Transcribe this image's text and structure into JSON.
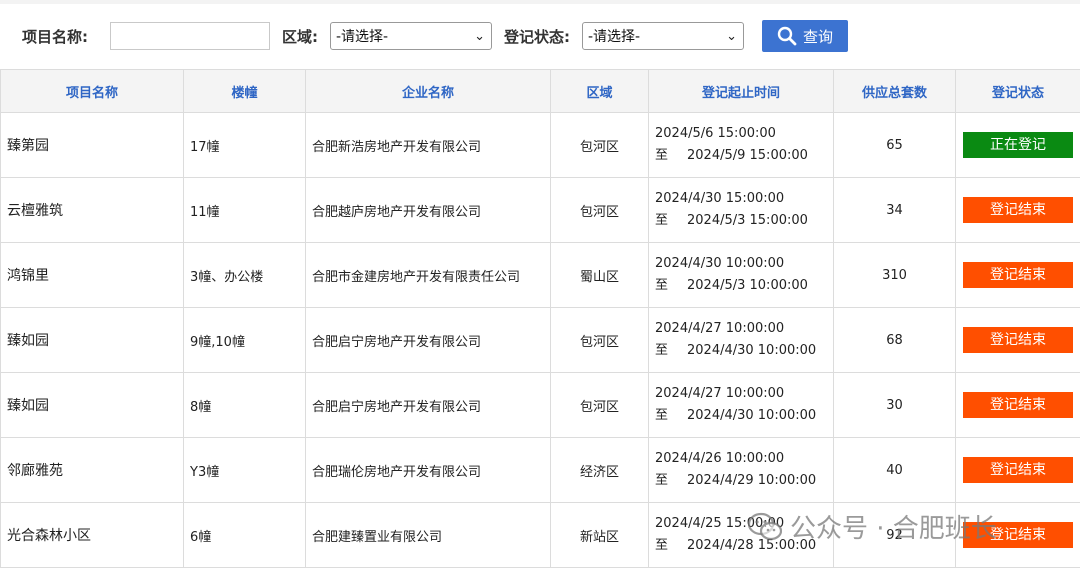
{
  "filters": {
    "project_label": "项目名称:",
    "project_value": "",
    "district_label": "区域:",
    "district_selected": "-请选择-",
    "status_label": "登记状态:",
    "status_selected": "-请选择-",
    "search_label": "查询",
    "search_icon": "search-icon"
  },
  "table": {
    "headers": [
      "项目名称",
      "楼幢",
      "企业名称",
      "区域",
      "登记起止时间",
      "供应总套数",
      "登记状态"
    ],
    "to_label": "至",
    "rows": [
      {
        "project": "臻第园",
        "building": "17幢",
        "company": "合肥新浩房地产开发有限公司",
        "district": "包河区",
        "start": "2024/5/6 15:00:00",
        "end": "2024/5/9 15:00:00",
        "total": "65",
        "status": "正在登记",
        "status_color": "#0a8a12"
      },
      {
        "project": "云檀雅筑",
        "building": "11幢",
        "company": "合肥越庐房地产开发有限公司",
        "district": "包河区",
        "start": "2024/4/30 15:00:00",
        "end": "2024/5/3 15:00:00",
        "total": "34",
        "status": "登记结束",
        "status_color": "#ff4f00"
      },
      {
        "project": "鸿锦里",
        "building": "3幢、办公楼",
        "company": "合肥市金建房地产开发有限责任公司",
        "district": "蜀山区",
        "start": "2024/4/30 10:00:00",
        "end": "2024/5/3 10:00:00",
        "total": "310",
        "status": "登记结束",
        "status_color": "#ff4f00"
      },
      {
        "project": "臻如园",
        "building": "9幢,10幢",
        "company": "合肥启宁房地产开发有限公司",
        "district": "包河区",
        "start": "2024/4/27 10:00:00",
        "end": "2024/4/30 10:00:00",
        "total": "68",
        "status": "登记结束",
        "status_color": "#ff4f00"
      },
      {
        "project": "臻如园",
        "building": "8幢",
        "company": "合肥启宁房地产开发有限公司",
        "district": "包河区",
        "start": "2024/4/27 10:00:00",
        "end": "2024/4/30 10:00:00",
        "total": "30",
        "status": "登记结束",
        "status_color": "#ff4f00"
      },
      {
        "project": "邻廊雅苑",
        "building": "Y3幢",
        "company": "合肥瑞伦房地产开发有限公司",
        "district": "经济区",
        "start": "2024/4/26 10:00:00",
        "end": "2024/4/29 10:00:00",
        "total": "40",
        "status": "登记结束",
        "status_color": "#ff4f00"
      },
      {
        "project": "光合森林小区",
        "building": "6幢",
        "company": "合肥建臻置业有限公司",
        "district": "新站区",
        "start": "2024/4/25 15:00:00",
        "end": "2024/4/28 15:00:00",
        "total": "92",
        "status": "登记结束",
        "status_color": "#ff4f00"
      }
    ]
  },
  "watermark": {
    "text": "公众号 · 合肥班长",
    "icon": "wechat-icon"
  }
}
